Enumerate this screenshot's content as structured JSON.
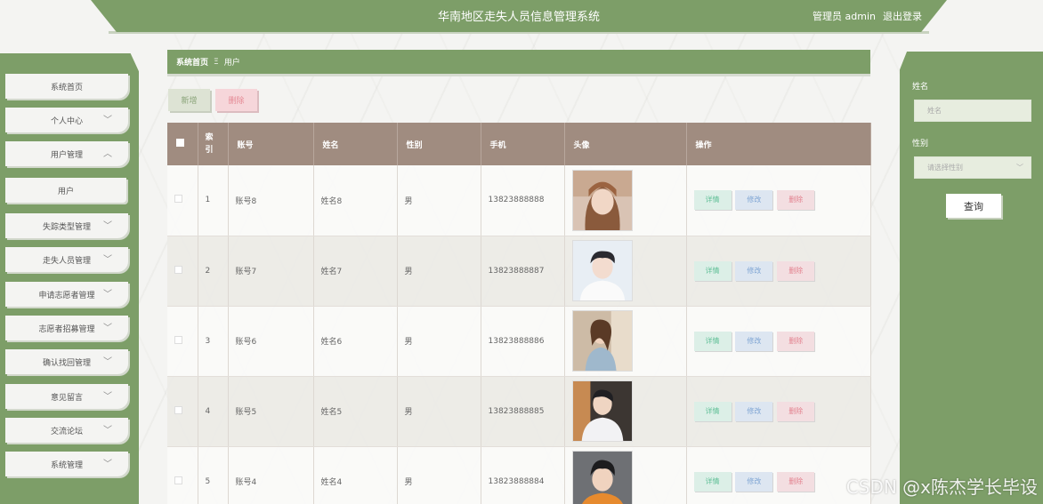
{
  "header": {
    "title": "华南地区走失人员信息管理系统",
    "user_label": "管理员 admin",
    "logout": "退出登录"
  },
  "sidebar": {
    "items": [
      {
        "label": "系统首页",
        "chevron": ""
      },
      {
        "label": "个人中心",
        "chevron": "﹀"
      },
      {
        "label": "用户管理",
        "chevron": "︿"
      },
      {
        "label": "用户",
        "chevron": ""
      },
      {
        "label": "失踪类型管理",
        "chevron": "﹀"
      },
      {
        "label": "走失人员管理",
        "chevron": "﹀"
      },
      {
        "label": "申请志愿者管理",
        "chevron": "﹀"
      },
      {
        "label": "志愿者招募管理",
        "chevron": "﹀"
      },
      {
        "label": "确认找回管理",
        "chevron": "﹀"
      },
      {
        "label": "意见留言",
        "chevron": "﹀"
      },
      {
        "label": "交流论坛",
        "chevron": "﹀"
      },
      {
        "label": "系统管理",
        "chevron": "﹀"
      }
    ]
  },
  "breadcrumb": {
    "home": "系统首页",
    "sep": "Ξ",
    "current": "用户"
  },
  "actions": {
    "add": "新增",
    "delete": "删除"
  },
  "table": {
    "headers": [
      "",
      "索引",
      "账号",
      "姓名",
      "性别",
      "手机",
      "头像",
      "操作"
    ],
    "index_header_line1": "索",
    "index_header_line2": "引",
    "rows": [
      {
        "index": "1",
        "account": "账号8",
        "name": "姓名8",
        "gender": "男",
        "phone": "13823888888"
      },
      {
        "index": "2",
        "account": "账号7",
        "name": "姓名7",
        "gender": "男",
        "phone": "13823888887"
      },
      {
        "index": "3",
        "account": "账号6",
        "name": "姓名6",
        "gender": "男",
        "phone": "13823888886"
      },
      {
        "index": "4",
        "account": "账号5",
        "name": "姓名5",
        "gender": "男",
        "phone": "13823888885"
      },
      {
        "index": "5",
        "account": "账号4",
        "name": "姓名4",
        "gender": "男",
        "phone": "13823888884"
      }
    ],
    "ops": {
      "detail": "详情",
      "edit": "修改",
      "remove": "删除"
    }
  },
  "search": {
    "name_label": "姓名",
    "name_placeholder": "姓名",
    "gender_label": "性别",
    "gender_placeholder": "请选择性别",
    "query_button": "查询"
  },
  "watermark": "CSDN @x陈杰学长毕设",
  "colors": {
    "brand_green": "#7d9e68",
    "table_header": "#a08c80"
  }
}
